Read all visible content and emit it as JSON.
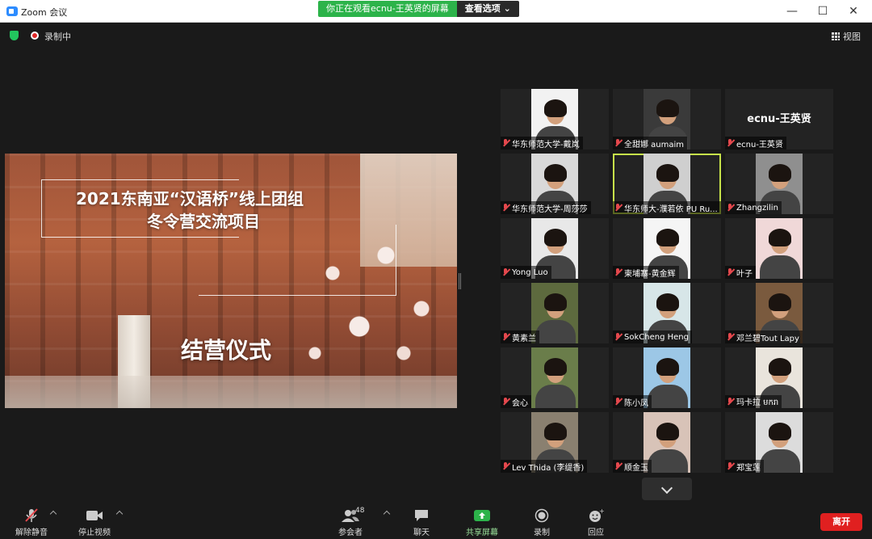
{
  "window": {
    "title": "Zoom 会议",
    "minimize": "—",
    "maximize": "☐",
    "close": "✕"
  },
  "share_banner": {
    "viewing_text": "你正在观看ecnu-王英贤的屏幕",
    "view_options": "查看选项 ⌄"
  },
  "top": {
    "recording": "录制中",
    "view": "视图"
  },
  "shared_screen": {
    "title_line1": "2021东南亚“汉语桥”线上团组",
    "title_line2": "冬令营交流项目",
    "subtitle": "结营仪式"
  },
  "participants": [
    {
      "name": "华东师范大学-戴岚",
      "bg": "#f2f2f2"
    },
    {
      "name": "全甜娜 aumaim",
      "bg": "#3a3a3a"
    },
    {
      "name": "ecnu-王英贤",
      "bg": "#232323",
      "video_off": true
    },
    {
      "name": "华东师范大学-周莎莎",
      "bg": "#d9d9d9"
    },
    {
      "name": "华东师大-濮若依 PU Ru...",
      "bg": "#cfcfcf",
      "active": true
    },
    {
      "name": "Zhangzilin",
      "bg": "#8f8f8f"
    },
    {
      "name": "Yong Luo",
      "bg": "#e8e8e8"
    },
    {
      "name": "柬埔寨-黄金辉",
      "bg": "#f5f5f5"
    },
    {
      "name": "叶子",
      "bg": "#f0d8d8"
    },
    {
      "name": "黄素兰",
      "bg": "#5d6a3e"
    },
    {
      "name": "SokCheng Heng",
      "bg": "#d7e6e8"
    },
    {
      "name": "邓兰碧Tout Lapy",
      "bg": "#7a5a3e"
    },
    {
      "name": "会心",
      "bg": "#6a7d4a"
    },
    {
      "name": "陈小凤",
      "bg": "#9cc7e6"
    },
    {
      "name": "玛卡拉 មករា",
      "bg": "#e9e4dc"
    },
    {
      "name": "Lev Thida (李缇香)",
      "bg": "#8a8070"
    },
    {
      "name": "顺金玉",
      "bg": "#d8c3b8"
    },
    {
      "name": "郑宝莲",
      "bg": "#dcdcdc"
    }
  ],
  "toolbar": {
    "unmute": "解除静音",
    "stop_video": "停止视频",
    "participants": "参会者",
    "participants_count": "48",
    "chat": "聊天",
    "share": "共享屏幕",
    "record": "录制",
    "reactions": "回应",
    "leave": "离开"
  },
  "colors": {
    "share_green": "#2cb34a",
    "leave_red": "#e02020",
    "active_speaker": "#c7e34a"
  }
}
